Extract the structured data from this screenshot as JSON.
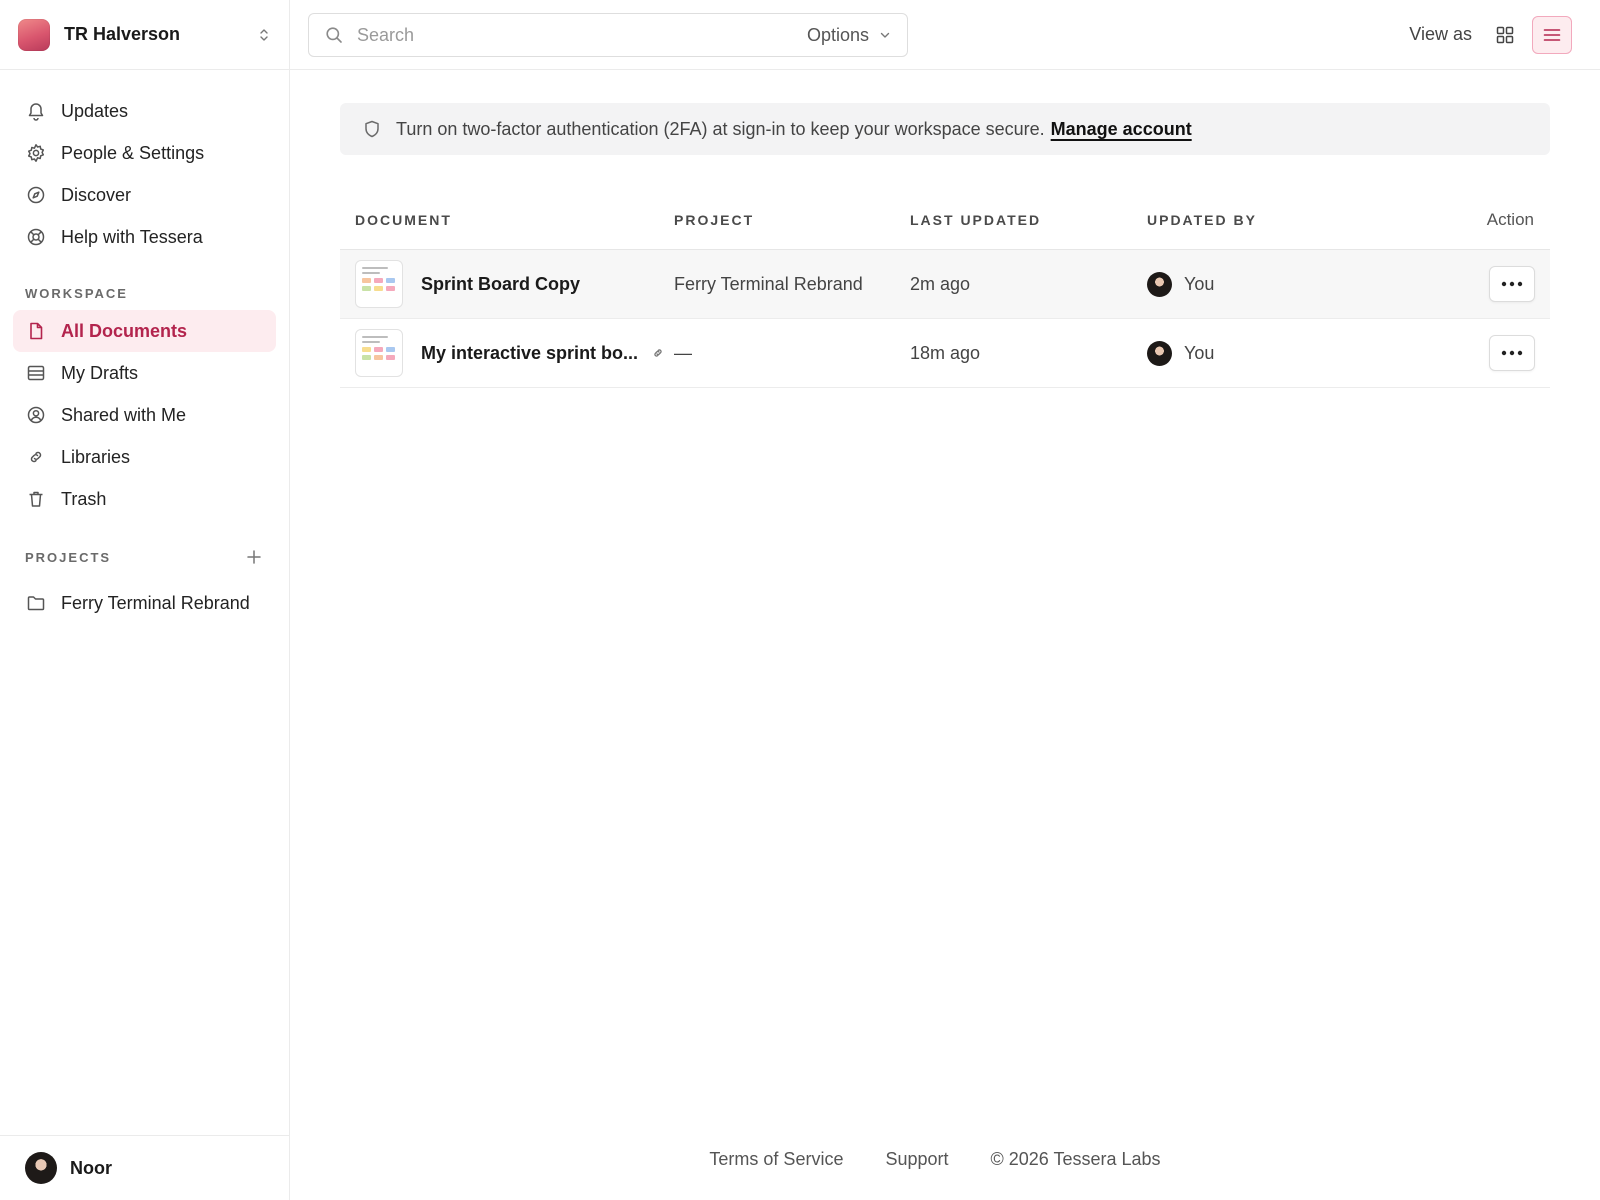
{
  "workspace": {
    "name": "TR Halverson"
  },
  "sidebar": {
    "primary": [
      {
        "label": "Updates",
        "icon": "bell-icon"
      },
      {
        "label": "People & Settings",
        "icon": "gear-icon"
      },
      {
        "label": "Discover",
        "icon": "compass-icon"
      },
      {
        "label": "Help with Tessera",
        "icon": "lifebuoy-icon"
      }
    ],
    "workspace_title": "WORKSPACE",
    "workspace_items": [
      {
        "label": "All Documents",
        "icon": "document-icon",
        "active": true
      },
      {
        "label": "My Drafts",
        "icon": "drafts-icon"
      },
      {
        "label": "Shared with Me",
        "icon": "user-circle-icon"
      },
      {
        "label": "Libraries",
        "icon": "link-icon"
      },
      {
        "label": "Trash",
        "icon": "trash-icon"
      }
    ],
    "projects_title": "PROJECTS",
    "projects": [
      {
        "label": "Ferry Terminal Rebrand",
        "icon": "folder-icon"
      }
    ],
    "user": {
      "name": "Noor"
    }
  },
  "topbar": {
    "search_placeholder": "Search",
    "options_label": "Options",
    "view_as_label": "View as"
  },
  "banner": {
    "text": "Turn on two-factor authentication (2FA) at sign-in to keep your workspace secure.",
    "link": "Manage account"
  },
  "table": {
    "headers": {
      "document": "DOCUMENT",
      "project": "PROJECT",
      "last_updated": "LAST UPDATED",
      "updated_by": "UPDATED BY",
      "action": "Action"
    },
    "rows": [
      {
        "title": "Sprint Board Copy",
        "project": "Ferry Terminal Rebrand",
        "updated": "2m ago",
        "by": "You",
        "linked": false
      },
      {
        "title": "My interactive sprint bo...",
        "project": "—",
        "updated": "18m ago",
        "by": "You",
        "linked": true
      }
    ]
  },
  "footer": {
    "terms": "Terms of Service",
    "support": "Support",
    "copyright": "© 2026 Tessera Labs"
  },
  "colors": {
    "accent": "#b3244d",
    "accent_bg": "#fdecef"
  }
}
